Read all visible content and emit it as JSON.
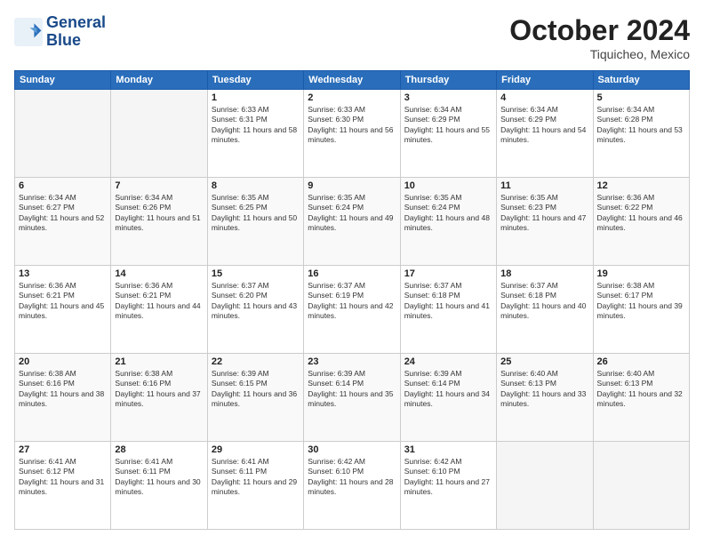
{
  "header": {
    "logo_line1": "General",
    "logo_line2": "Blue",
    "month": "October 2024",
    "location": "Tiquicheo, Mexico"
  },
  "weekdays": [
    "Sunday",
    "Monday",
    "Tuesday",
    "Wednesday",
    "Thursday",
    "Friday",
    "Saturday"
  ],
  "weeks": [
    [
      {
        "day": "",
        "info": ""
      },
      {
        "day": "",
        "info": ""
      },
      {
        "day": "1",
        "info": "Sunrise: 6:33 AM\nSunset: 6:31 PM\nDaylight: 11 hours and 58 minutes."
      },
      {
        "day": "2",
        "info": "Sunrise: 6:33 AM\nSunset: 6:30 PM\nDaylight: 11 hours and 56 minutes."
      },
      {
        "day": "3",
        "info": "Sunrise: 6:34 AM\nSunset: 6:29 PM\nDaylight: 11 hours and 55 minutes."
      },
      {
        "day": "4",
        "info": "Sunrise: 6:34 AM\nSunset: 6:29 PM\nDaylight: 11 hours and 54 minutes."
      },
      {
        "day": "5",
        "info": "Sunrise: 6:34 AM\nSunset: 6:28 PM\nDaylight: 11 hours and 53 minutes."
      }
    ],
    [
      {
        "day": "6",
        "info": "Sunrise: 6:34 AM\nSunset: 6:27 PM\nDaylight: 11 hours and 52 minutes."
      },
      {
        "day": "7",
        "info": "Sunrise: 6:34 AM\nSunset: 6:26 PM\nDaylight: 11 hours and 51 minutes."
      },
      {
        "day": "8",
        "info": "Sunrise: 6:35 AM\nSunset: 6:25 PM\nDaylight: 11 hours and 50 minutes."
      },
      {
        "day": "9",
        "info": "Sunrise: 6:35 AM\nSunset: 6:24 PM\nDaylight: 11 hours and 49 minutes."
      },
      {
        "day": "10",
        "info": "Sunrise: 6:35 AM\nSunset: 6:24 PM\nDaylight: 11 hours and 48 minutes."
      },
      {
        "day": "11",
        "info": "Sunrise: 6:35 AM\nSunset: 6:23 PM\nDaylight: 11 hours and 47 minutes."
      },
      {
        "day": "12",
        "info": "Sunrise: 6:36 AM\nSunset: 6:22 PM\nDaylight: 11 hours and 46 minutes."
      }
    ],
    [
      {
        "day": "13",
        "info": "Sunrise: 6:36 AM\nSunset: 6:21 PM\nDaylight: 11 hours and 45 minutes."
      },
      {
        "day": "14",
        "info": "Sunrise: 6:36 AM\nSunset: 6:21 PM\nDaylight: 11 hours and 44 minutes."
      },
      {
        "day": "15",
        "info": "Sunrise: 6:37 AM\nSunset: 6:20 PM\nDaylight: 11 hours and 43 minutes."
      },
      {
        "day": "16",
        "info": "Sunrise: 6:37 AM\nSunset: 6:19 PM\nDaylight: 11 hours and 42 minutes."
      },
      {
        "day": "17",
        "info": "Sunrise: 6:37 AM\nSunset: 6:18 PM\nDaylight: 11 hours and 41 minutes."
      },
      {
        "day": "18",
        "info": "Sunrise: 6:37 AM\nSunset: 6:18 PM\nDaylight: 11 hours and 40 minutes."
      },
      {
        "day": "19",
        "info": "Sunrise: 6:38 AM\nSunset: 6:17 PM\nDaylight: 11 hours and 39 minutes."
      }
    ],
    [
      {
        "day": "20",
        "info": "Sunrise: 6:38 AM\nSunset: 6:16 PM\nDaylight: 11 hours and 38 minutes."
      },
      {
        "day": "21",
        "info": "Sunrise: 6:38 AM\nSunset: 6:16 PM\nDaylight: 11 hours and 37 minutes."
      },
      {
        "day": "22",
        "info": "Sunrise: 6:39 AM\nSunset: 6:15 PM\nDaylight: 11 hours and 36 minutes."
      },
      {
        "day": "23",
        "info": "Sunrise: 6:39 AM\nSunset: 6:14 PM\nDaylight: 11 hours and 35 minutes."
      },
      {
        "day": "24",
        "info": "Sunrise: 6:39 AM\nSunset: 6:14 PM\nDaylight: 11 hours and 34 minutes."
      },
      {
        "day": "25",
        "info": "Sunrise: 6:40 AM\nSunset: 6:13 PM\nDaylight: 11 hours and 33 minutes."
      },
      {
        "day": "26",
        "info": "Sunrise: 6:40 AM\nSunset: 6:13 PM\nDaylight: 11 hours and 32 minutes."
      }
    ],
    [
      {
        "day": "27",
        "info": "Sunrise: 6:41 AM\nSunset: 6:12 PM\nDaylight: 11 hours and 31 minutes."
      },
      {
        "day": "28",
        "info": "Sunrise: 6:41 AM\nSunset: 6:11 PM\nDaylight: 11 hours and 30 minutes."
      },
      {
        "day": "29",
        "info": "Sunrise: 6:41 AM\nSunset: 6:11 PM\nDaylight: 11 hours and 29 minutes."
      },
      {
        "day": "30",
        "info": "Sunrise: 6:42 AM\nSunset: 6:10 PM\nDaylight: 11 hours and 28 minutes."
      },
      {
        "day": "31",
        "info": "Sunrise: 6:42 AM\nSunset: 6:10 PM\nDaylight: 11 hours and 27 minutes."
      },
      {
        "day": "",
        "info": ""
      },
      {
        "day": "",
        "info": ""
      }
    ]
  ]
}
